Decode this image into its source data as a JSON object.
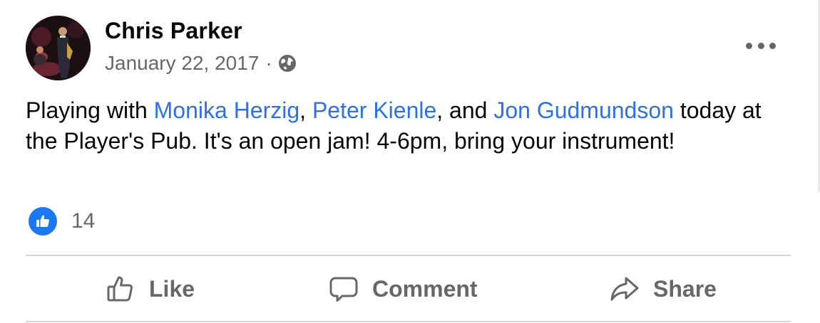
{
  "post": {
    "author": "Chris Parker",
    "date": "January 22, 2017",
    "separator": "·",
    "privacy_icon": "globe-icon",
    "body": {
      "prefix": "Playing with ",
      "mention1": "Monika Herzig",
      "sep1": ", ",
      "mention2": "Peter Kienle",
      "sep2": ", and ",
      "mention3": "Jon Gudmundson",
      "suffix": " today at the Player's Pub. It's an open jam! 4-6pm, bring your instrument!"
    },
    "reactions": {
      "icon": "thumbs-up-icon",
      "count": "14"
    }
  },
  "actions": {
    "like": "Like",
    "comment": "Comment",
    "share": "Share"
  },
  "colors": {
    "mention": "#2d72e0",
    "secondary_text": "#65676b",
    "like_badge": "#1a78f2"
  }
}
